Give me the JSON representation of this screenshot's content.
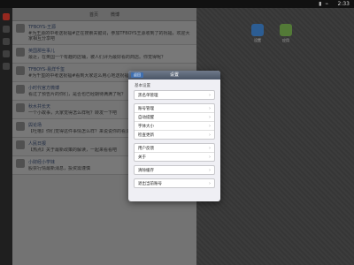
{
  "status_bar": {
    "time": "2:33",
    "icons": "▮ ⌁"
  },
  "feed": {
    "tabs": [
      "首页",
      "微博"
    ],
    "items": [
      {
        "name": "TFBOYS-王源",
        "text": "#为王源的中考送祝福#正在搜索关键词，参加TFBOYS王源收到了的祝福，欢迎大家相互分享吧"
      },
      {
        "name": "英国那些事儿",
        "text": "最近，在英国一个有趣的店铺，被人们评为最好看的商店。你觉得呢？"
      },
      {
        "name": "TFBOYS-易烊千玺",
        "text": "#为千玺的中考送祝福#看到大家这么用心地送祝福，非常感动，谢谢你们"
      },
      {
        "name": "小时代官方微博",
        "text": "看过了预告片的你们，是否也已经期待满满了呢？"
      },
      {
        "name": "秋水共长天",
        "text": "一个小故事，大家觉得怎么样呢？转发一下吧"
      },
      {
        "name": "舆论场",
        "text": "【吐槽】你们觉得这件事情怎么样？来说说你的看法吧"
      },
      {
        "name": "人民日报",
        "text": "【热点】关于最新政策的解读，一起来看看吧"
      },
      {
        "name": "小财经小学妹",
        "text": "股票行情最新消息，投资需谨慎"
      }
    ]
  },
  "desktop": {
    "apps": [
      "设置",
      "应用"
    ]
  },
  "dialog": {
    "back_label": "返回",
    "title": "设置",
    "section_title": "基本设置",
    "groups": [
      {
        "rows": [
          "黑名单管理"
        ]
      },
      {
        "rows": [
          "账号管理",
          "自动提醒",
          "字体大小",
          "检查更新"
        ]
      },
      {
        "rows": [
          "用户反馈",
          "关于"
        ]
      },
      {
        "rows": [
          "清除缓存"
        ]
      },
      {
        "rows": [
          "退出当前账号"
        ]
      }
    ]
  }
}
